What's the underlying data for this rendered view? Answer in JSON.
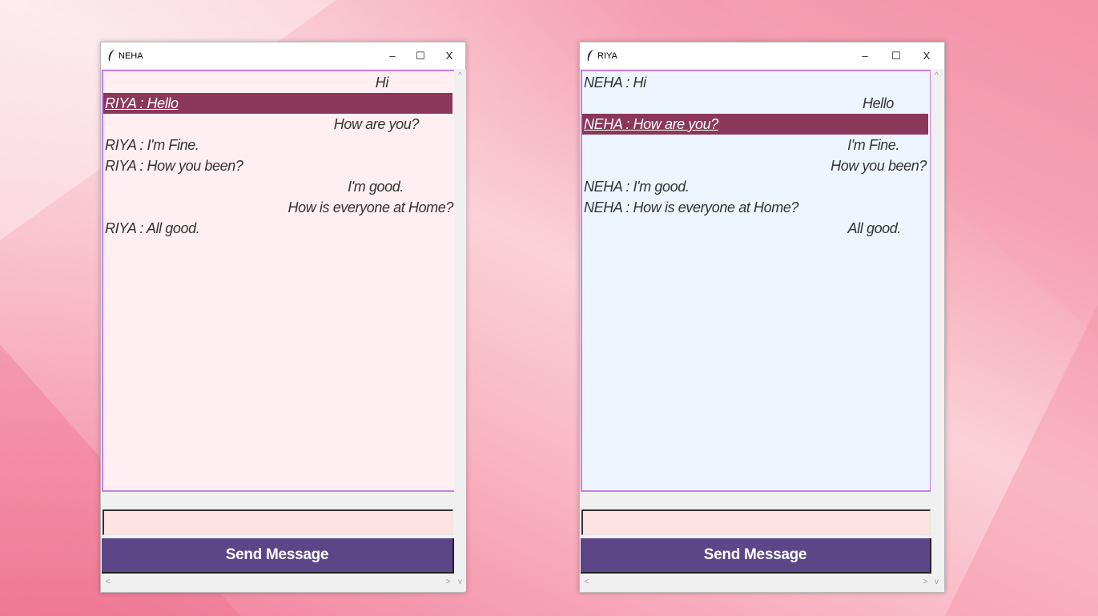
{
  "windows": [
    {
      "title": "NEHA",
      "controls": {
        "minimize": "–",
        "maximize": "☐",
        "close": "X"
      },
      "chat_bg": "#ffeff2",
      "messages": [
        {
          "text": "Hi",
          "align": "right-indent"
        },
        {
          "text": "RIYA : Hello",
          "align": "left",
          "selected": true
        },
        {
          "text": "How are you?",
          "align": "right-indent"
        },
        {
          "text": "RIYA : I'm Fine.",
          "align": "left"
        },
        {
          "text": "RIYA : How you been?",
          "align": "left"
        },
        {
          "text": "I'm good.",
          "align": "right-indent"
        },
        {
          "text": "How is everyone at Home?",
          "align": "right"
        },
        {
          "text": "RIYA : All good.",
          "align": "left"
        }
      ],
      "input_value": "",
      "send_label": "Send Message"
    },
    {
      "title": "RIYA",
      "controls": {
        "minimize": "–",
        "maximize": "☐",
        "close": "X"
      },
      "chat_bg": "#edf6ff",
      "messages": [
        {
          "text": "NEHA : Hi",
          "align": "left"
        },
        {
          "text": "Hello",
          "align": "right-indent"
        },
        {
          "text": "NEHA : How are you?",
          "align": "left",
          "selected": true
        },
        {
          "text": "I'm Fine.",
          "align": "right-indent"
        },
        {
          "text": "How you been?",
          "align": "right"
        },
        {
          "text": "NEHA : I'm good.",
          "align": "left"
        },
        {
          "text": "NEHA : How is everyone at Home?",
          "align": "left"
        },
        {
          "text": "All good.",
          "align": "right-indent"
        }
      ],
      "input_value": "",
      "send_label": "Send Message"
    }
  ],
  "colors": {
    "chat_border": "#c77ee6",
    "selected_row": "#8b3759",
    "send_button": "#5c4688",
    "entry_bg": "#ffe2e2"
  },
  "icons": {
    "app": "feather-icon",
    "scroll_up": "^",
    "scroll_down": "v",
    "scroll_left": "<",
    "scroll_right": ">"
  }
}
